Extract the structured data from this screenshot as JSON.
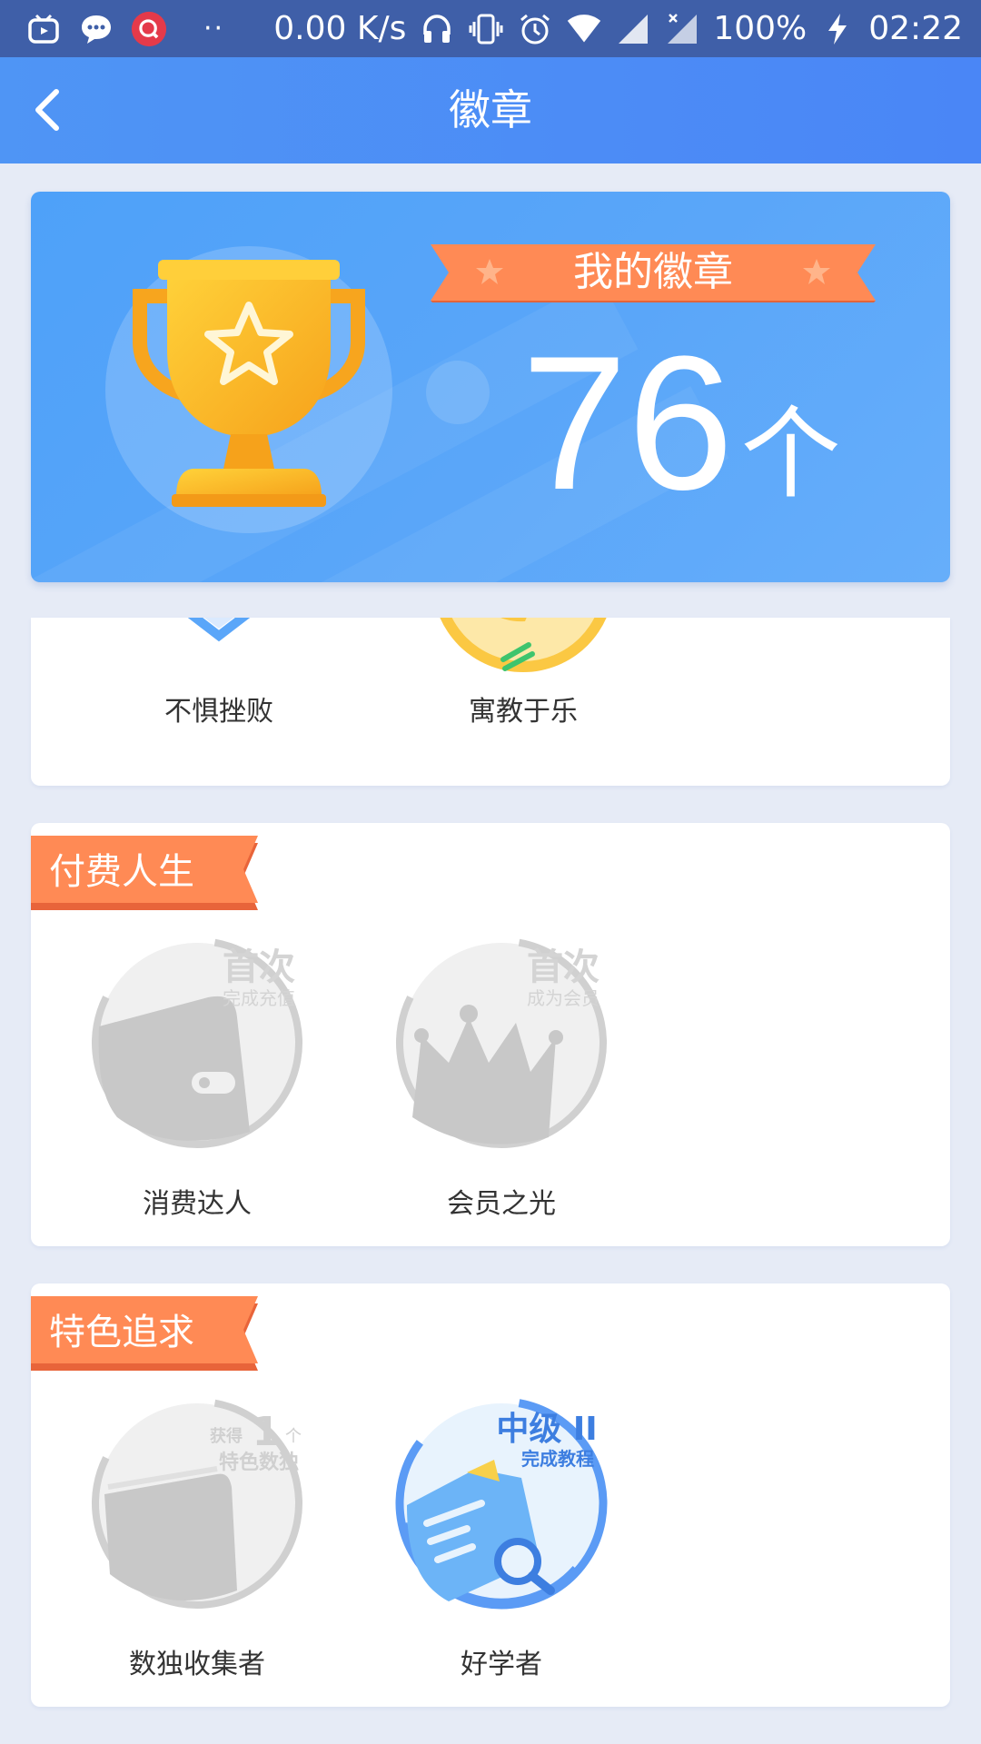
{
  "status_bar": {
    "network_speed": "0.00 K/s",
    "battery": "100%",
    "time": "02:22"
  },
  "nav": {
    "title": "徽章"
  },
  "hero": {
    "ribbon_title": "我的徽章",
    "count": "76",
    "unit": "个"
  },
  "section_top": {
    "badges": [
      {
        "label": "不惧挫败",
        "earned": true
      },
      {
        "label": "寓教于乐",
        "earned": true
      }
    ]
  },
  "section_paid": {
    "title": "付费人生",
    "badges": [
      {
        "label": "消费达人",
        "earned": false,
        "tag_big": "首次",
        "tag_small": "完成充值"
      },
      {
        "label": "会员之光",
        "earned": false,
        "tag_big": "首次",
        "tag_small": "成为会员"
      }
    ]
  },
  "section_feature": {
    "title": "特色追求",
    "badges": [
      {
        "label": "数独收集者",
        "earned": false,
        "tag_prefix": "获得",
        "tag_num": "1",
        "tag_unit": "个",
        "tag_small": "特色数独"
      },
      {
        "label": "好学者",
        "earned": true,
        "tag_big": "中级 II",
        "tag_small": "完成教程"
      }
    ]
  },
  "colors": {
    "nav_bg": "#4a86f6",
    "status_bg": "#3f5fa8",
    "ribbon_orange": "#ff8a55",
    "hero_blue": "#5aa6f9",
    "badge_gray": "#c8c8c8",
    "badge_blue": "#5b9bf5"
  }
}
